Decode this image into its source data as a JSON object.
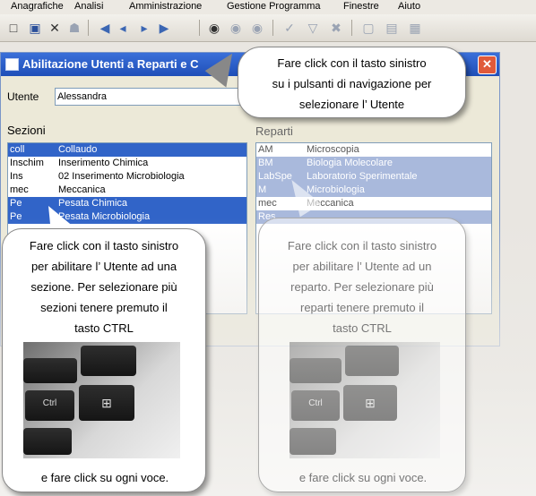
{
  "menu": [
    "Anagrafiche",
    "Analisi",
    "Amministrazione",
    "Gestione Programma",
    "Finestre",
    "Aiuto"
  ],
  "toolbar_icons": [
    "new-icon",
    "save-icon",
    "delete-icon",
    "shield-icon",
    "first-record-icon",
    "previous-record-icon",
    "next-record-icon",
    "last-record-icon",
    "find-icon",
    "find-previous-icon",
    "find-next-icon",
    "check-icon",
    "filter-icon",
    "clear-filter-icon",
    "window-icon",
    "copy-icon",
    "library-icon"
  ],
  "dialog": {
    "title": "Abilitazione Utenti a Reparti e C"
  },
  "utente": {
    "label": "Utente",
    "value": "Alessandra"
  },
  "sezioni": {
    "label": "Sezioni",
    "rows": [
      {
        "code": "coll",
        "desc": "Collaudo",
        "selected": true
      },
      {
        "code": "Inschim",
        "desc": "Inserimento Chimica",
        "selected": false
      },
      {
        "code": "Ins",
        "desc": "02 Inserimento Microbiologia",
        "selected": false
      },
      {
        "code": "mec",
        "desc": "Meccanica",
        "selected": false
      },
      {
        "code": "Pe",
        "desc": "Pesata Chimica",
        "selected": true
      },
      {
        "code": "Pe",
        "desc": "Pesata Microbiologia",
        "selected": true
      }
    ]
  },
  "reparti": {
    "label": "Reparti",
    "rows": [
      {
        "code": "AM",
        "desc": "Microscopia",
        "selected": false
      },
      {
        "code": "BM",
        "desc": "Biologia Molecolare",
        "selected": true
      },
      {
        "code": "LabSpe",
        "desc": "Laboratorio Sperimentale",
        "selected": true
      },
      {
        "code": "M",
        "desc": "Microbiologia",
        "selected": true
      },
      {
        "code": "mec",
        "desc": "Meccanica",
        "selected": false
      },
      {
        "code": "Res",
        "desc": "",
        "selected": true
      }
    ]
  },
  "callouts": {
    "nav": [
      "Fare click con il tasto sinistro",
      "su i pulsanti di navigazione per",
      "selezionare l’ Utente"
    ],
    "sezione": [
      "Fare click con il tasto sinistro",
      "per abilitare l’ Utente ad una",
      "sezione. Per selezionare  più",
      "sezioni tenere premuto il",
      "tasto CTRL"
    ],
    "reparto": [
      "Fare click con il tasto sinistro",
      "per abilitare l’ Utente ad un",
      "reparto. Per selezionare  più",
      "reparti tenere premuto il",
      "tasto CTRL"
    ],
    "footer": "e fare click su ogni voce."
  },
  "keyboard": {
    "ctrl_label": "Ctrl"
  }
}
